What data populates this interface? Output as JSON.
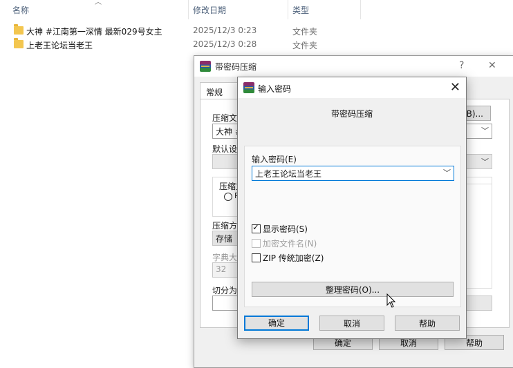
{
  "explorer": {
    "columns": {
      "name": "名称",
      "date": "修改日期",
      "type": "类型"
    },
    "rows": [
      {
        "name": "大神 #江南第一深情 最新029号女主",
        "date": "2025/12/3 0:23",
        "type": "文件夹"
      },
      {
        "name": "上老王论坛当老王",
        "date": "2025/12/3 0:28",
        "type": "文件夹"
      }
    ]
  },
  "back_dialog": {
    "title": "带密码压缩",
    "help": "?",
    "close": "✕",
    "tab_general": "常规",
    "label_archive": "压缩文",
    "archive_value": "大神 #",
    "browse_button": "(B)...",
    "label_default": "默认设",
    "group_format": "压缩文",
    "radio_partial": "R",
    "label_method": "压缩方",
    "method_value": "存储",
    "label_dict": "字典大",
    "dict_value": "32",
    "label_split": "切分为",
    "ok_button": "确定",
    "cancel_button": "取消",
    "help_button": "帮助"
  },
  "front_dialog": {
    "title": "输入密码",
    "close": "✕",
    "subtitle": "带密码压缩",
    "password_label": "输入密码(E)",
    "password_value": "上老王论坛当老王",
    "show_password": {
      "label": "显示密码(S)",
      "checked": true
    },
    "encrypt_names": {
      "label": "加密文件名(N)",
      "checked": false,
      "disabled": true
    },
    "zip_legacy": {
      "label": "ZIP 传统加密(Z)",
      "checked": false
    },
    "organize_button": "整理密码(O)...",
    "ok_button": "确定",
    "cancel_button": "取消",
    "help_button": "帮助"
  },
  "colors": {
    "accent": "#0078d7",
    "folder": "#f3c64f",
    "dialog_bg": "#f0f0f0"
  }
}
